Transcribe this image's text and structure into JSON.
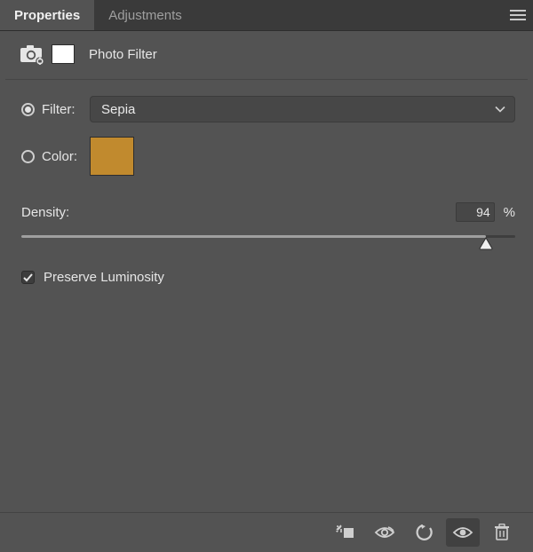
{
  "tabs": {
    "properties": "Properties",
    "adjustments": "Adjustments",
    "active": "properties"
  },
  "layer": {
    "title": "Photo Filter",
    "icon": "camera-adjustment-icon",
    "mask_icon": "layer-mask-icon"
  },
  "filter": {
    "mode": "filter",
    "radio_filter_label": "Filter:",
    "radio_color_label": "Color:",
    "selected_preset": "Sepia",
    "color_hex": "#c18a2e"
  },
  "density": {
    "label": "Density:",
    "value": "94",
    "unit": "%",
    "percent": 94
  },
  "preserve_luminosity": {
    "label": "Preserve Luminosity",
    "checked": true
  },
  "footer": {
    "clip_to_layer": "clip-to-layer-icon",
    "view_previous": "view-previous-state-icon",
    "reset": "reset-to-default-icon",
    "visibility": "visibility-icon",
    "delete": "trash-icon",
    "visibility_active": true
  }
}
